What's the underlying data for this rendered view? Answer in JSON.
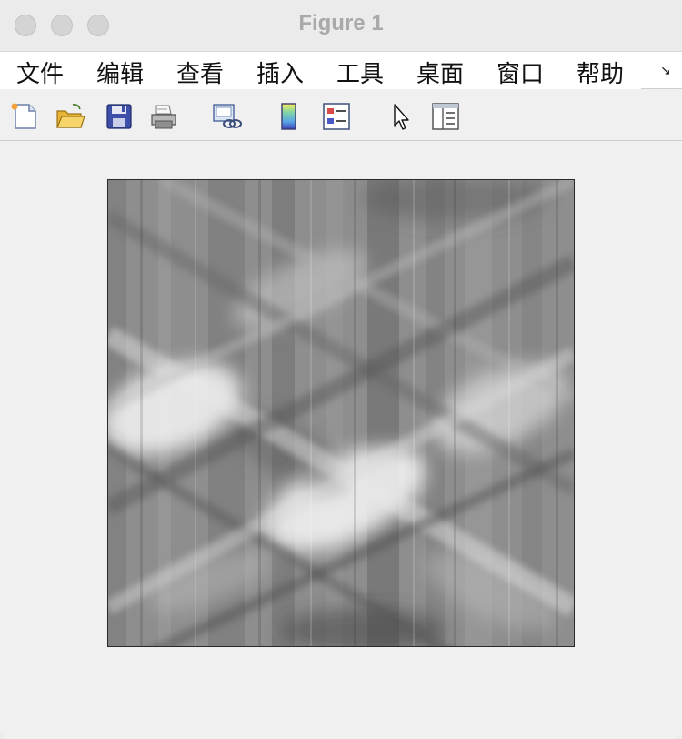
{
  "window": {
    "title": "Figure 1"
  },
  "menu": {
    "items": [
      "文件",
      "编辑",
      "查看",
      "插入",
      "工具",
      "桌面",
      "窗口",
      "帮助"
    ],
    "overflow_glyph": "↘"
  },
  "toolbar": {
    "tools": [
      {
        "name": "new-figure-icon"
      },
      {
        "name": "open-file-icon"
      },
      {
        "name": "save-icon"
      },
      {
        "name": "print-icon"
      },
      {
        "name": "link-plot-icon"
      },
      {
        "name": "colorbar-icon"
      },
      {
        "name": "legend-icon"
      },
      {
        "name": "pointer-icon"
      },
      {
        "name": "property-inspector-icon"
      }
    ]
  },
  "figure": {
    "colormap": "gray",
    "content": "grayscale image with crossing diagonal streaks and vertical bands"
  }
}
